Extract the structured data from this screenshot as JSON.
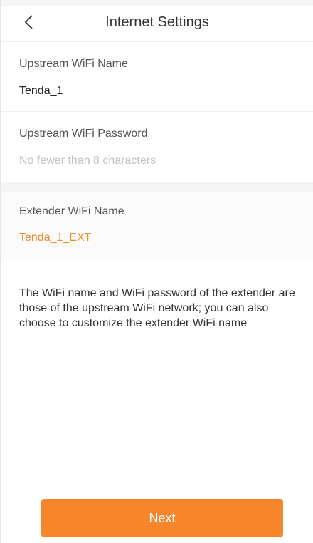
{
  "header": {
    "title": "Internet Settings",
    "back_icon": "chevron-left-icon"
  },
  "upstream_name": {
    "label": "Upstream WiFi Name",
    "value": "Tenda_1"
  },
  "upstream_password": {
    "label": "Upstream WiFi Password",
    "placeholder": "No fewer than 8 characters",
    "value": ""
  },
  "extender_name": {
    "label": "Extender WiFi Name",
    "value": "Tenda_1_EXT"
  },
  "description": "The WiFi name and WiFi password of the extender are those of the upstream WiFi network; you can also choose to customize the extender WiFi name",
  "next_button": {
    "label": "Next"
  },
  "colors": {
    "accent": "#f7852b",
    "extender_value": "#f08a2c",
    "placeholder": "#c4c4c4"
  }
}
